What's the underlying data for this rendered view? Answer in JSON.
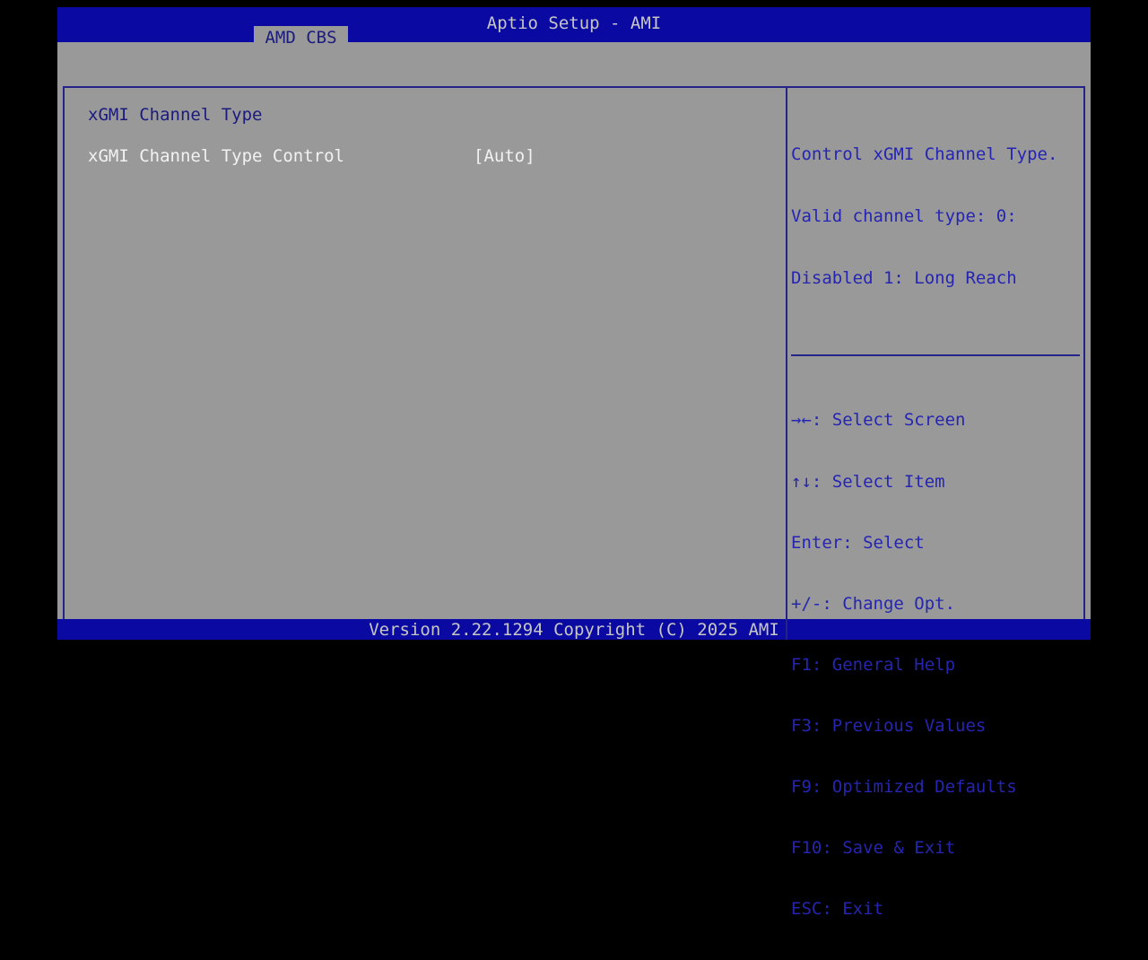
{
  "window": {
    "title": "Aptio Setup - AMI"
  },
  "tabs": [
    {
      "label": "AMD CBS",
      "active": true
    }
  ],
  "menu": {
    "section_title": "xGMI Channel Type",
    "items": [
      {
        "label": "xGMI Channel Type Control",
        "value": "[Auto]",
        "selected": true
      }
    ]
  },
  "help_panel": {
    "description_lines": [
      "Control xGMI Channel Type.",
      "Valid channel type: 0:",
      "Disabled 1: Long Reach"
    ],
    "hotkeys": [
      "→←: Select Screen",
      "↑↓: Select Item",
      "Enter: Select",
      "+/-: Change Opt.",
      "F1: General Help",
      "F3: Previous Values",
      "F9: Optimized Defaults",
      "F10: Save & Exit",
      "ESC: Exit"
    ]
  },
  "footer": {
    "version_text": "Version 2.22.1294 Copyright (C) 2025 AMI"
  },
  "colors": {
    "title_bar_blue": "#0a0aa2",
    "body_gray": "#999999",
    "border_navy": "#242489",
    "section_text_navy": "#1b1b7e",
    "help_text_blue": "#2525b2",
    "selected_item_white": "#f2f2f2",
    "bar_text_silver": "#c6c6c6"
  }
}
